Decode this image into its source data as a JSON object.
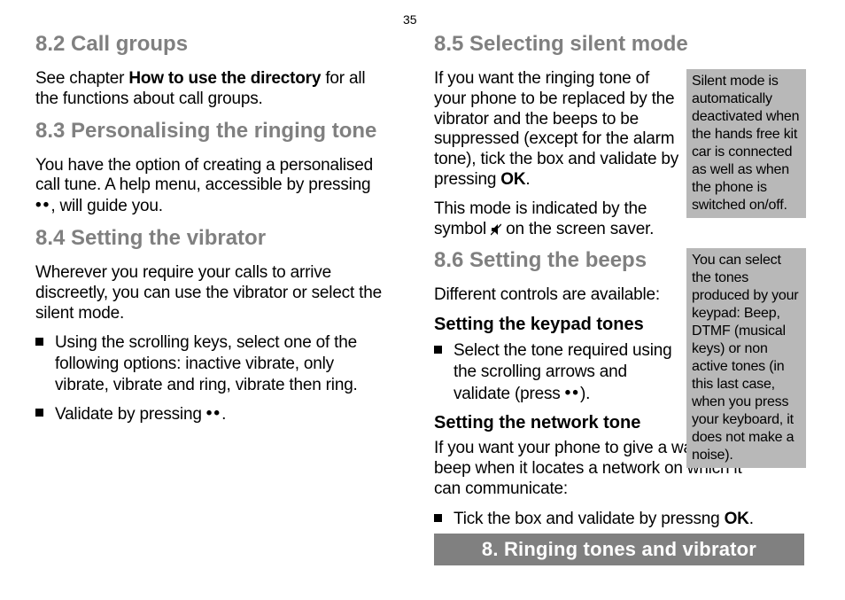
{
  "page_number": "35",
  "left": {
    "s82": {
      "heading": "8.2  Call groups",
      "p1_a": "See chapter ",
      "p1_b": "How to use the directory",
      "p1_c": " for all the functions about call groups."
    },
    "s83": {
      "heading": "8.3  Personalising the ringing tone",
      "p1_a": "You have the option of creating a personalised call tune. A help menu, accessible by pressing ",
      "p1_dots": "••",
      "p1_b": ", will guide you."
    },
    "s84": {
      "heading": "8.4  Setting the vibrator",
      "p1": "Wherever you require your calls to arrive discreetly, you can use the vibrator or select the silent mode.",
      "li1": "Using the scrolling keys, select one of the following options: inactive vibrate, only vibrate, vibrate and ring, vibrate then ring.",
      "li2_a": "Validate by pressing ",
      "li2_dots": "••",
      "li2_b": "."
    }
  },
  "right": {
    "s85": {
      "heading": "8.5  Selecting silent mode",
      "p1_a": "If you want the ringing tone of your phone to be replaced by the vibrator and the beeps to be suppressed (except for the alarm tone), tick the box and validate by  pressing ",
      "p1_b": "OK",
      "p1_c": ".",
      "p2_a": "This mode is indicated by the symbol ",
      "p2_b": " on the screen saver."
    },
    "s86": {
      "heading": "8.6  Setting the beeps",
      "p1": "Different controls are available:",
      "sub1": "Setting the keypad tones",
      "li1_a": "Select the tone required using the scrolling arrows and validate (press ",
      "li1_dots": "••",
      "li1_b": ").",
      "sub2": "Setting the network tone",
      "p2": "If you want your phone to give a warning beep when it locates a network on which it can communicate:",
      "li2_a": "Tick the box and validate by pressng ",
      "li2_b": "OK",
      "li2_c": "."
    }
  },
  "notes": {
    "n1": "Silent mode is automatically deactivated when the hands free kit car is connected as well as when the phone is switched on/off.",
    "n2": "You can select the tones produced by your keypad: Beep, DTMF (musical keys) or non active tones (in this last case, when you press your keyboard, it does not make a noise)."
  },
  "chapter_bar": "8. Ringing tones and vibrator"
}
